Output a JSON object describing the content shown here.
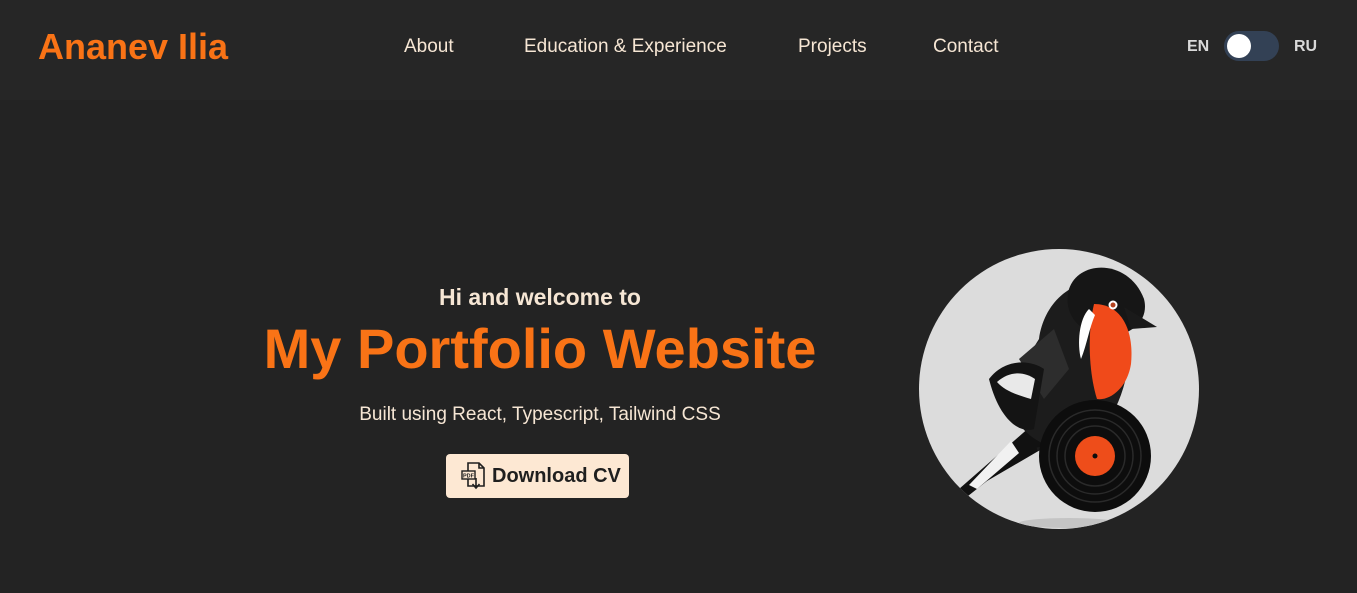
{
  "header": {
    "logo": "Ananev Ilia",
    "nav": [
      "About",
      "Education & Experience",
      "Projects",
      "Contact"
    ],
    "lang_left": "EN",
    "lang_right": "RU"
  },
  "hero": {
    "greeting": "Hi and welcome to",
    "title": "My Portfolio Website",
    "subtitle": "Built using React, Typescript, Tailwind CSS",
    "cv_button": "Download CV",
    "cv_icon_text": "PDF"
  },
  "colors": {
    "accent": "#f97316",
    "background": "#232323",
    "header_background": "#262626",
    "text": "#f6e6d4",
    "button_background": "#fde8d3",
    "toggle_track": "#334155"
  },
  "icons": {
    "cv": "pdf-download-icon",
    "avatar": "bird-with-vinyl-record-illustration"
  }
}
